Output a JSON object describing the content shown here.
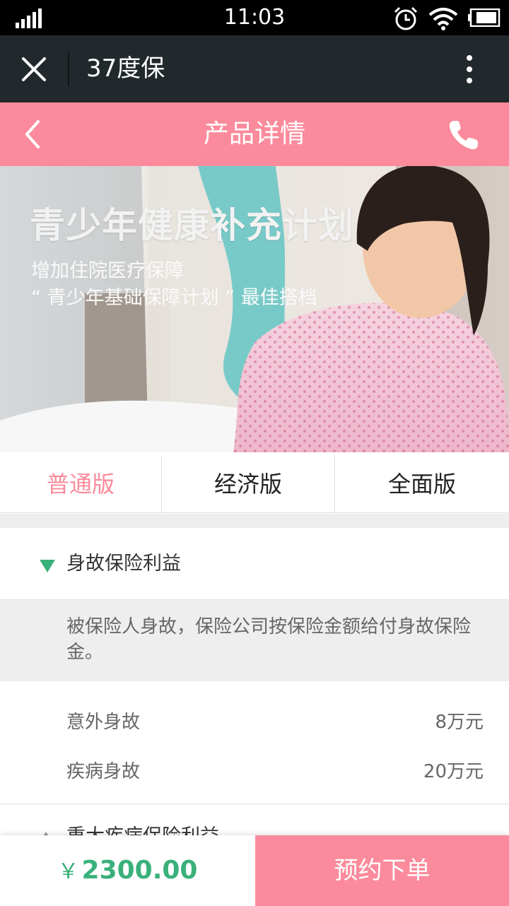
{
  "status_bar": {
    "time": "11:03"
  },
  "wechat_bar": {
    "title": "37度保"
  },
  "nav": {
    "title": "产品详情"
  },
  "banner": {
    "headline": "青少年健康补充计划",
    "subline_1": "增加住院医疗保障",
    "subline_2": "“ 青少年基础保障计划 ” 最佳搭档"
  },
  "plan_tabs": [
    {
      "label": "普通版",
      "active": true
    },
    {
      "label": "经济版",
      "active": false
    },
    {
      "label": "全面版",
      "active": false
    }
  ],
  "sections": [
    {
      "title": "身故保险利益",
      "expanded": true,
      "description": "被保险人身故，保险公司按保险金额给付身故保险金。",
      "rows": [
        {
          "label": "意外身故",
          "value": "8万元"
        },
        {
          "label": "疾病身故",
          "value": "20万元"
        }
      ]
    },
    {
      "title": "重大疾病保险利益",
      "expanded": false
    }
  ],
  "footer": {
    "currency": "￥",
    "price": "2300.00",
    "order_label": "预约下单"
  },
  "colors": {
    "brand_pink": "#fb8b9c",
    "price_green": "#3ab07a",
    "toggle_green": "#3ab07a",
    "wechat_bar": "#22292c"
  }
}
